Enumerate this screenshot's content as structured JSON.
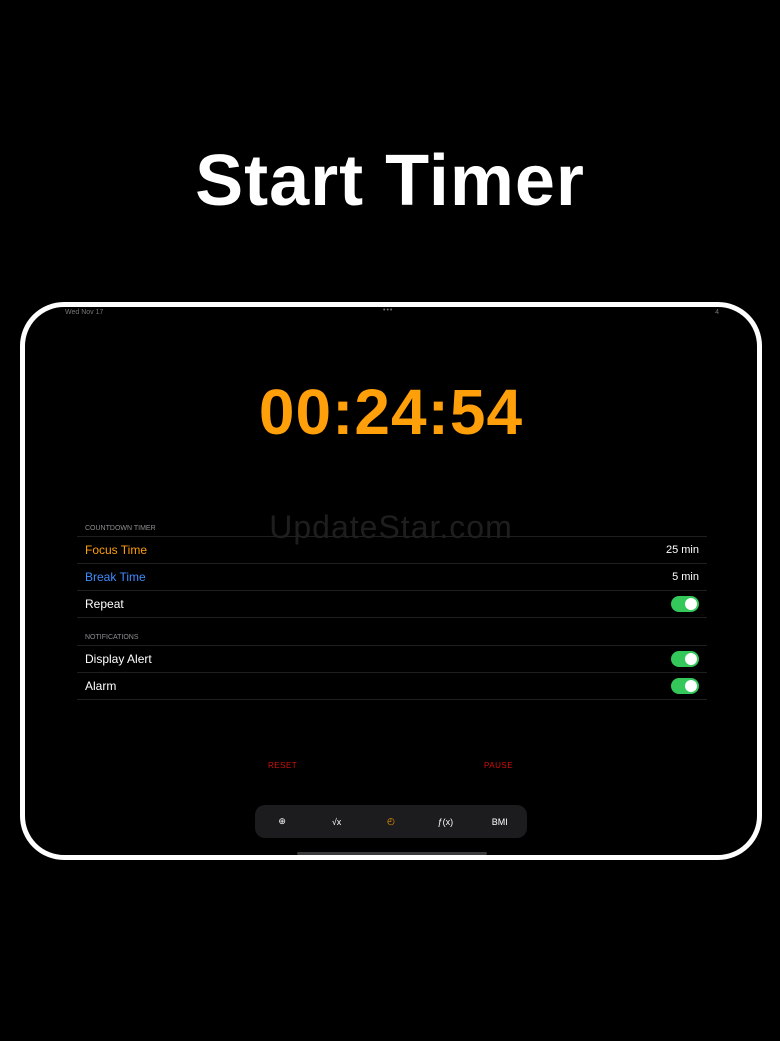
{
  "headline": "Start Timer",
  "status_bar": {
    "date": "Wed Nov 17",
    "dots": "•••",
    "right": "4"
  },
  "timer": "00:24:54",
  "watermark": "UpdateStar.com",
  "countdown": {
    "header": "COUNTDOWN TIMER",
    "rows": [
      {
        "label": "Focus Time",
        "value": "25 min"
      },
      {
        "label": "Break Time",
        "value": "5 min"
      },
      {
        "label": "Repeat",
        "toggle": true
      }
    ]
  },
  "notifications": {
    "header": "NOTIFICATIONS",
    "rows": [
      {
        "label": "Display Alert",
        "toggle": true
      },
      {
        "label": "Alarm",
        "toggle": true
      }
    ]
  },
  "actions": {
    "reset": "RESET",
    "pause": "PAUSE"
  },
  "tabs": [
    {
      "label": "⊕",
      "icon": "plus-minus-icon"
    },
    {
      "label": "√x",
      "icon": "square-root-icon"
    },
    {
      "label": "◴",
      "icon": "timer-icon",
      "active": true
    },
    {
      "label": "ƒ(x)",
      "icon": "function-icon"
    },
    {
      "label": "BMI",
      "icon": "bmi-icon"
    }
  ],
  "colors": {
    "accent": "#ff9f0a",
    "blue": "#3f8cff",
    "toggle_on": "#34c759",
    "destructive": "#d1100a"
  }
}
